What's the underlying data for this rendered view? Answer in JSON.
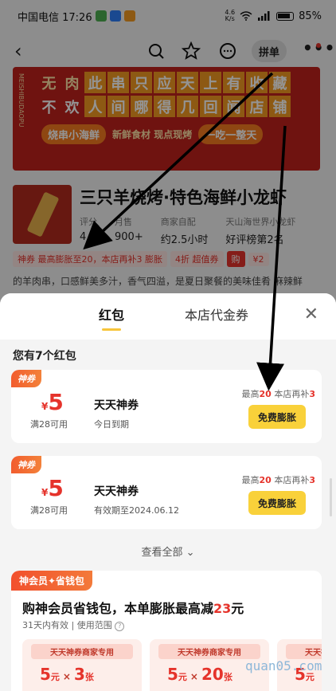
{
  "status_bar": {
    "carrier_time": "中国电信 17:26",
    "net_speed_value": "4.6",
    "net_speed_unit": "K/s",
    "battery": "85%"
  },
  "nav": {
    "back_glyph": "‹",
    "group_buy_label": "拼单",
    "more_glyph": "•••"
  },
  "banner": {
    "side_text": "MEISHIBUDAOPU",
    "line1": [
      "无",
      "肉",
      "此",
      "串",
      "只",
      "应",
      "天",
      "上",
      "有",
      "收",
      "藏"
    ],
    "line2": [
      "不",
      "欢",
      "人",
      "间",
      "哪",
      "得",
      "几",
      "回",
      "闻",
      "店",
      "铺"
    ],
    "tag1": "烧串小海鲜",
    "mid_text": "新鲜食材 现点现烤",
    "tag2": "一吃一整天"
  },
  "shop": {
    "name": "三只羊烧烤·特色海鲜小龙虾",
    "stats": [
      {
        "key": "评分",
        "value": "4.8"
      },
      {
        "key": "月售",
        "value": "900+"
      },
      {
        "key": "商家自配",
        "value": "约2.5小时"
      },
      {
        "key": "天山海世界小龙虾",
        "value": "好评榜第2名"
      }
    ],
    "promo1": "神券 最高膨胀至20，本店再补3 膨胀",
    "promo2": "4折 超值券",
    "promo3": "购",
    "promo4": "¥2",
    "description": "的羊肉串，口感鲜美多汁，香气四溢，是夏日聚餐的美味佳肴   麻辣鲜"
  },
  "sheet": {
    "tab_active": "红包",
    "tab_other": "本店代金券",
    "close_glyph": "✕",
    "count_text": "您有7个红包",
    "view_all": "查看全部",
    "coupons": [
      {
        "badge": "神券",
        "currency": "¥",
        "amount": "5",
        "min_spend": "满28可用",
        "title": "天天神券",
        "validity": "今日到期",
        "max_prefix": "最高",
        "max_value": "20",
        "max_mid": " 本店再补",
        "max_extra": "3",
        "button": "免费膨胀"
      },
      {
        "badge": "神券",
        "currency": "¥",
        "amount": "5",
        "min_spend": "满28可用",
        "title": "天天神券",
        "validity": "有效期至2024.06.12",
        "max_prefix": "最高",
        "max_value": "20",
        "max_mid": " 本店再补",
        "max_extra": "3",
        "button": "免费膨胀"
      }
    ],
    "member": {
      "badge": "神会员✦省钱包",
      "title_prefix": "购神会员省钱包，本单膨胀最高减",
      "title_value": "23",
      "title_suffix": "元",
      "subtitle": "31天内有效 | 使用范围",
      "cards": [
        {
          "header": "天天神券商家专用",
          "amount": "5",
          "unit": "元",
          "times": "×",
          "count": "3",
          "count_unit": "张"
        },
        {
          "header": "天天神券商家专用",
          "amount": "5",
          "unit": "元",
          "times": "×",
          "count": "20",
          "count_unit": "张"
        },
        {
          "header": "天天神券商家专用",
          "amount": "5",
          "unit": "元",
          "times": "",
          "count": "",
          "count_unit": ""
        }
      ]
    }
  },
  "watermark": "quan05.com",
  "colors": {
    "accent_red": "#e5332b",
    "button_yellow": "#f9d13a",
    "banner_red": "#c0221c"
  }
}
